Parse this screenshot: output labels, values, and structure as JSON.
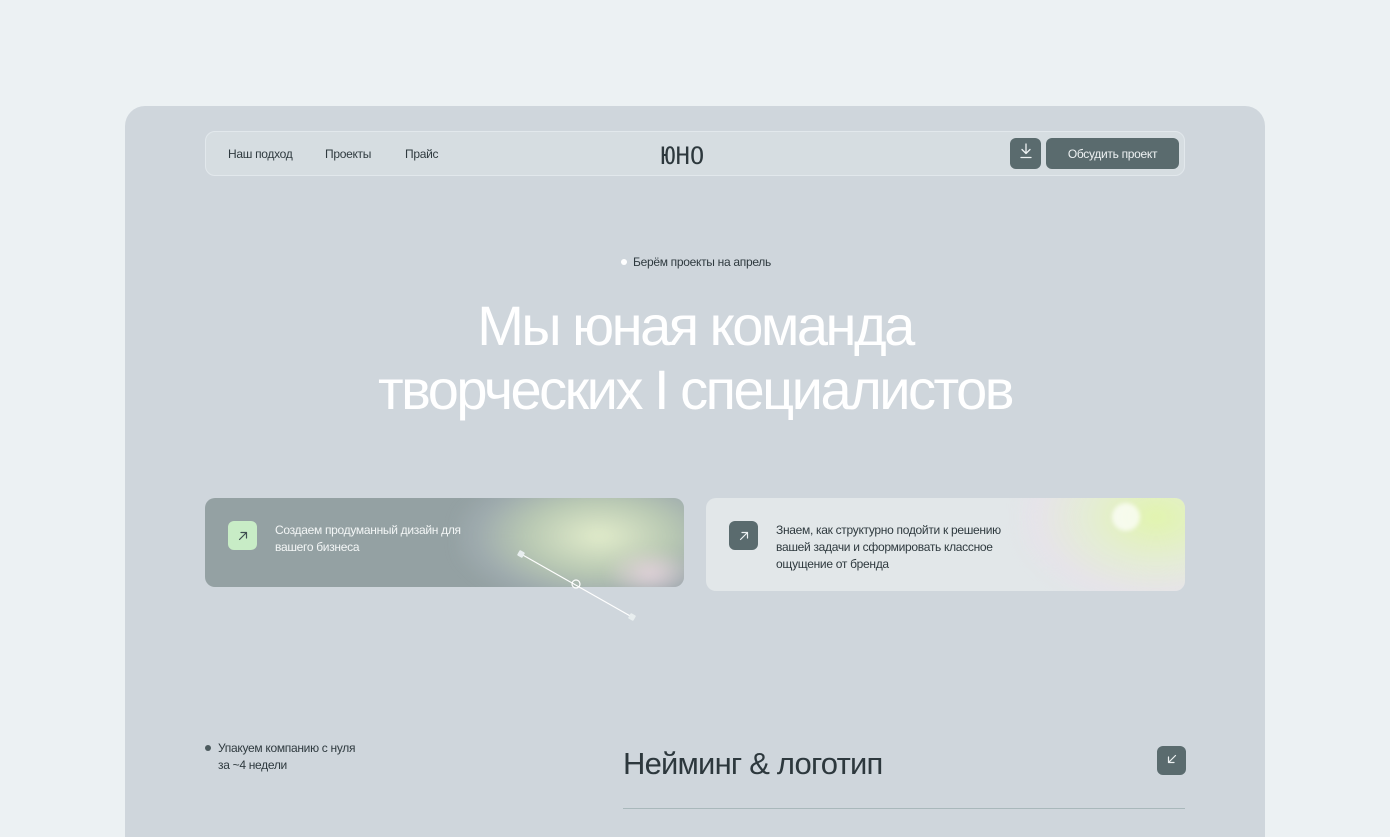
{
  "nav": {
    "links": [
      "Наш подход",
      "Проекты",
      "Прайс"
    ],
    "logo": "ЮНО",
    "download_icon": "download-icon",
    "cta_label": "Обсудить проект"
  },
  "hero": {
    "tagline": "Берём проекты на апрель",
    "title_line1": "Мы юная команда",
    "title_line2": "творческих I специалистов"
  },
  "cards": [
    {
      "icon": "arrow-up-right-icon",
      "text": "Создаем продуманный дизайн для вашего бизнеса"
    },
    {
      "icon": "arrow-up-right-icon",
      "text": "Знаем, как структурно подойти к решению вашей задачи и сформировать классное ощущение от бренда"
    }
  ],
  "section": {
    "note_line1": "Упакуем компанию с нуля",
    "note_line2": "за ~4 недели",
    "title": "Нейминг & логотип",
    "corner_icon": "arrow-down-left-icon"
  },
  "colors": {
    "page_bg": "#ecf1f3",
    "frame_bg": "#cfd6dc",
    "accent_dark": "#5a6b6e",
    "accent_green": "#c8ecc6"
  }
}
